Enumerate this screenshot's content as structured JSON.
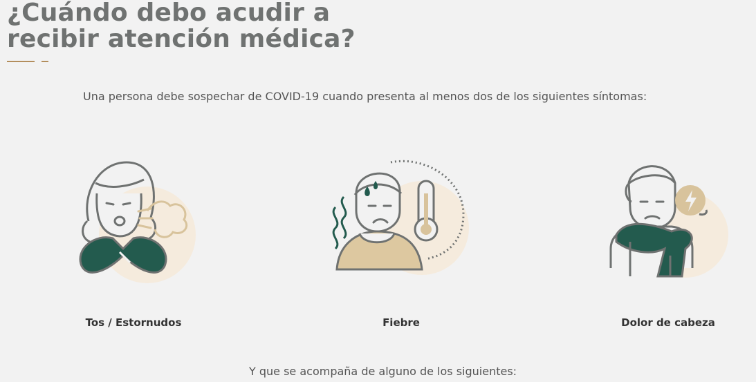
{
  "heading": {
    "line1": "¿Cuándo debo acudir a",
    "line2": "recibir atención médica?"
  },
  "intro_text": "Una persona debe sospechar de COVID-19 cuando presenta al menos dos de los siguientes síntomas:",
  "symptoms": [
    {
      "label": "Tos / Estornudos",
      "icon": "coughing-person-icon"
    },
    {
      "label": "Fiebre",
      "icon": "fever-person-icon"
    },
    {
      "label": "Dolor de cabeza",
      "icon": "headache-person-icon"
    }
  ],
  "outro_text": "Y que se acompaña de alguno de los siguientes:",
  "colors": {
    "background": "#f2f2f2",
    "heading": "#6f7271",
    "accent_gold": "#b38e5d",
    "green": "#235b4e",
    "beige": "#f5ebdd",
    "outline": "#6f7271"
  }
}
